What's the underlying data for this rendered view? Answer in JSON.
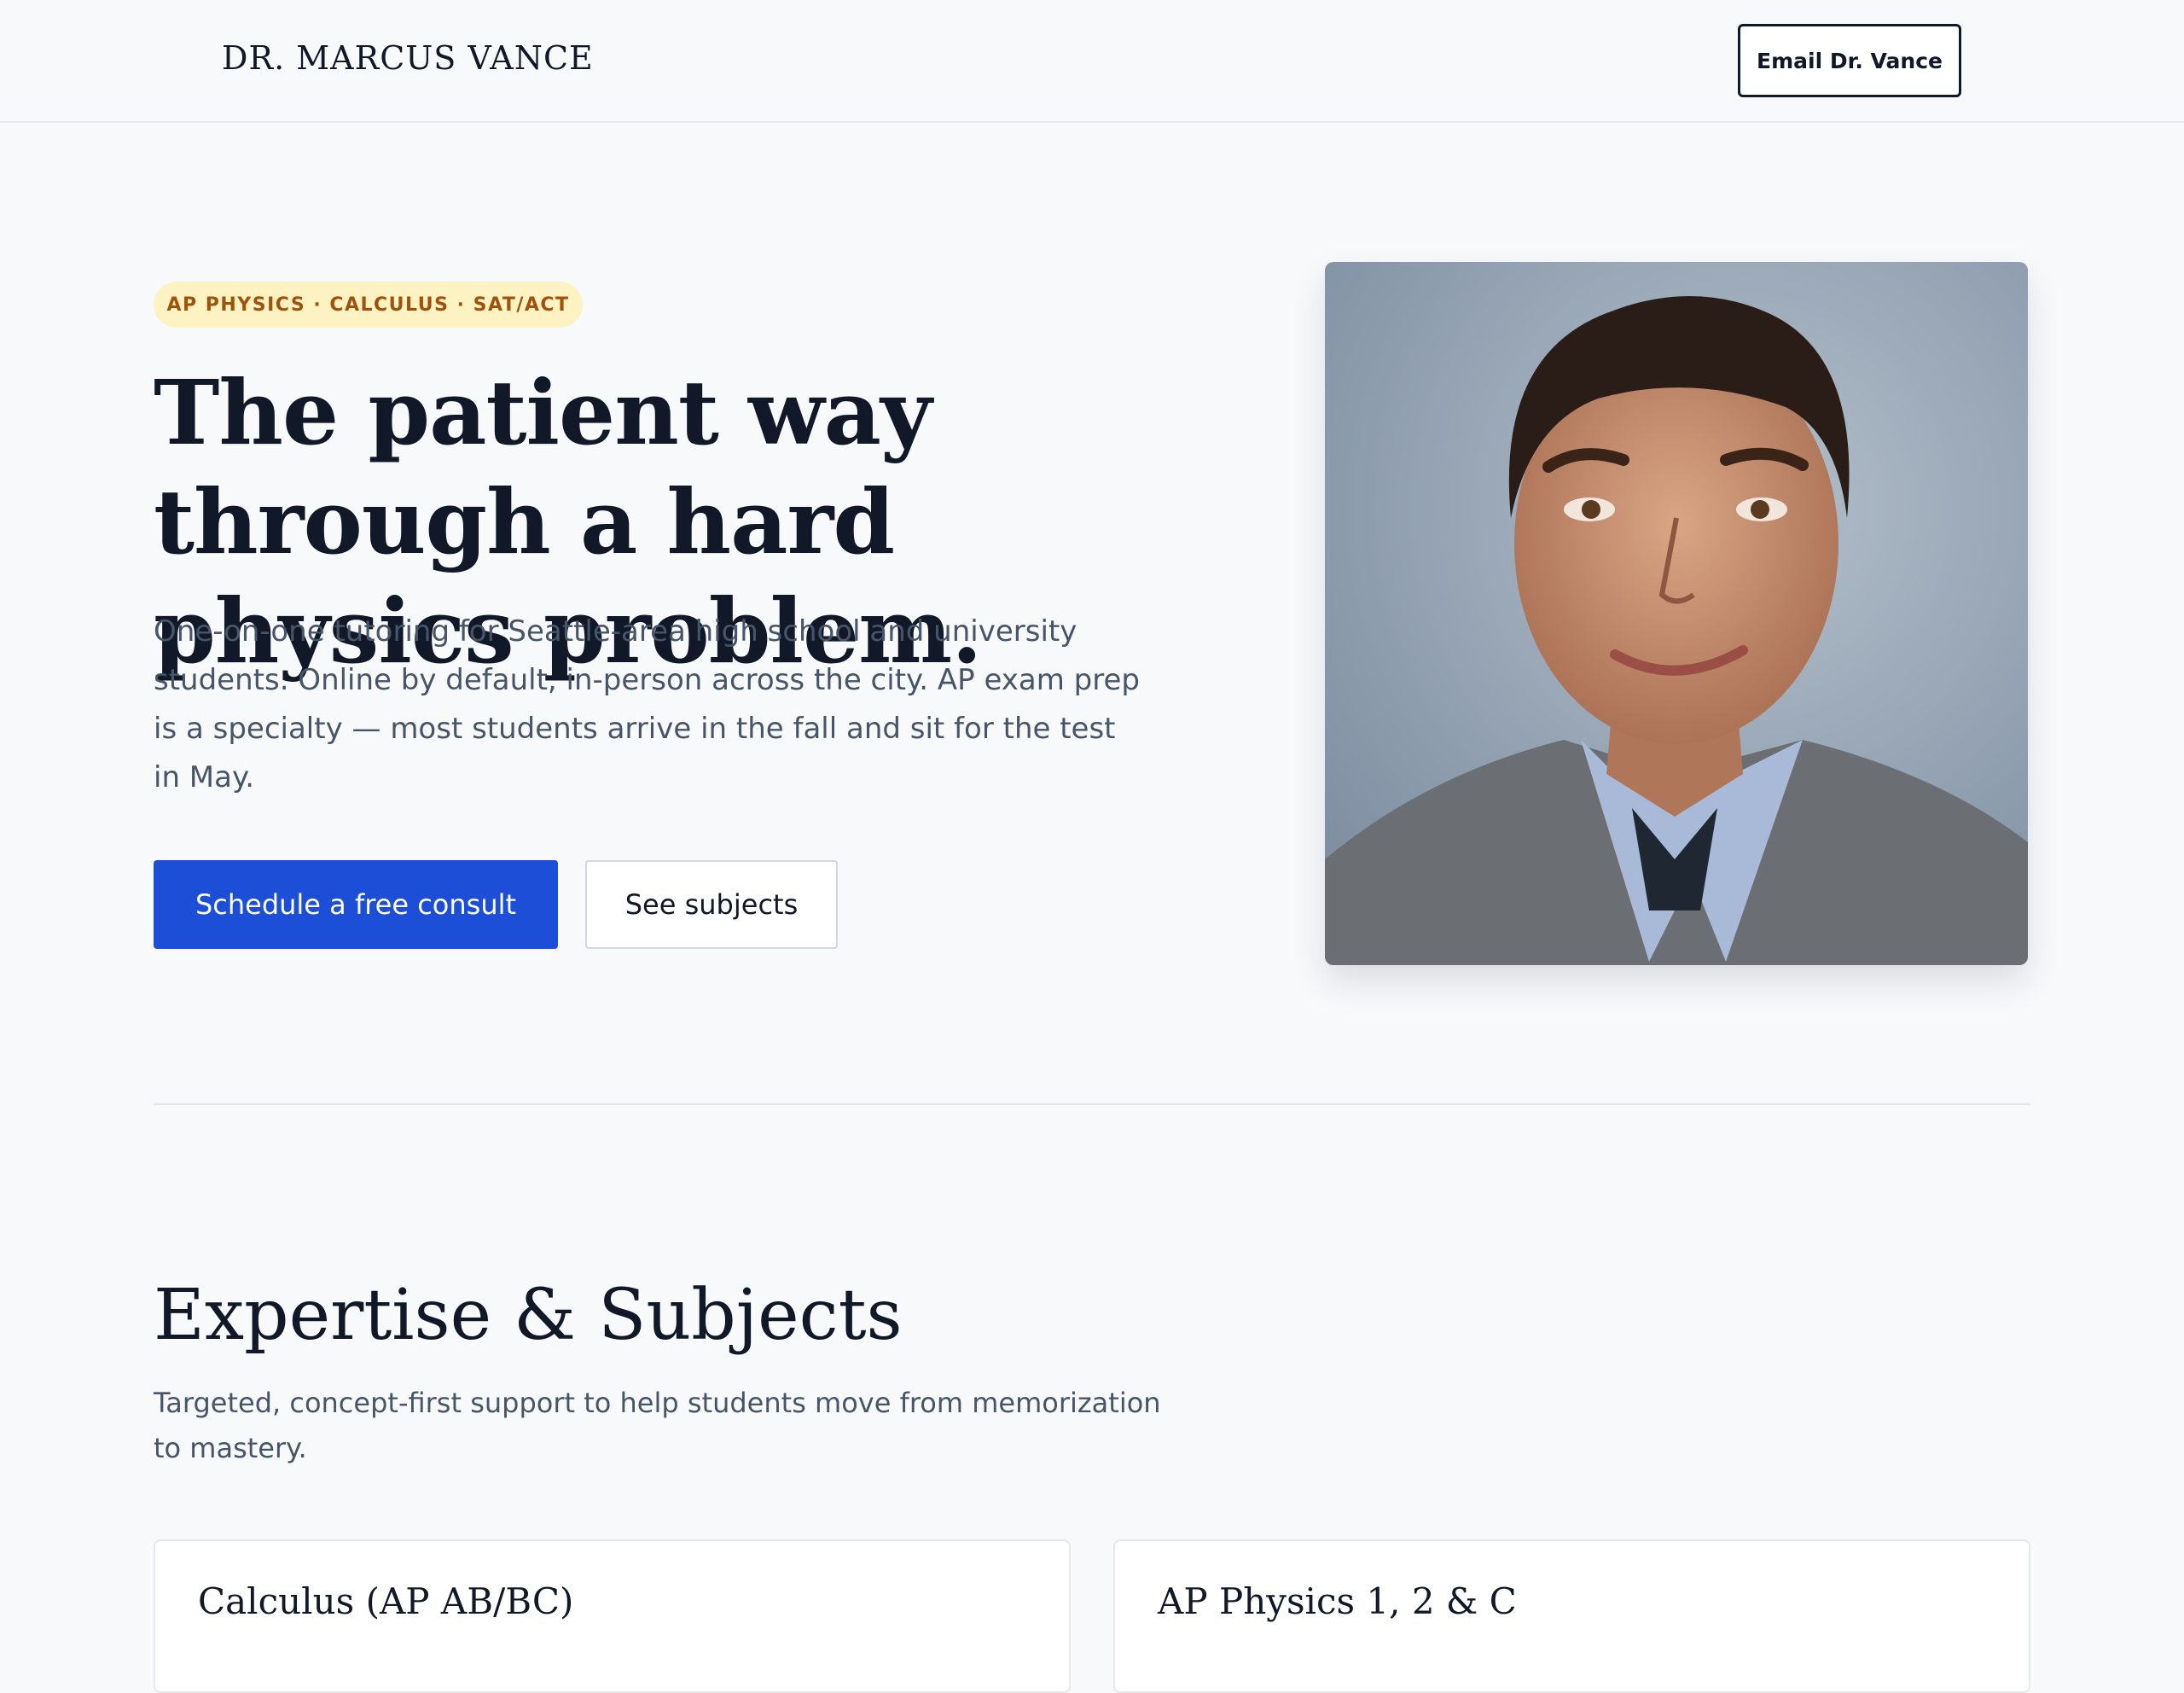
{
  "header": {
    "logo": "DR. MARCUS VANCE",
    "email_button": "Email Dr. Vance"
  },
  "hero": {
    "badge": "AP PHYSICS · CALCULUS · SAT/ACT",
    "title": "The patient way through a hard physics problem.",
    "description": "One-on-one tutoring for Seattle-area high school and university students. Online by default, in-person across the city. AP exam prep is a specialty — most students arrive in the fall and sit for the test in May.",
    "primary_cta": "Schedule a free consult",
    "secondary_cta": "See subjects"
  },
  "expertise": {
    "title": "Expertise & Subjects",
    "subtitle": "Targeted, concept-first support to help students move from memorization to mastery.",
    "cards": [
      {
        "title": "Calculus (AP AB/BC)"
      },
      {
        "title": "AP Physics 1, 2 & C"
      }
    ]
  },
  "colors": {
    "accent": "#1d4ed8",
    "badge_bg": "#fdf2c2",
    "badge_text": "#a0520c",
    "background": "#f8f9fb"
  }
}
